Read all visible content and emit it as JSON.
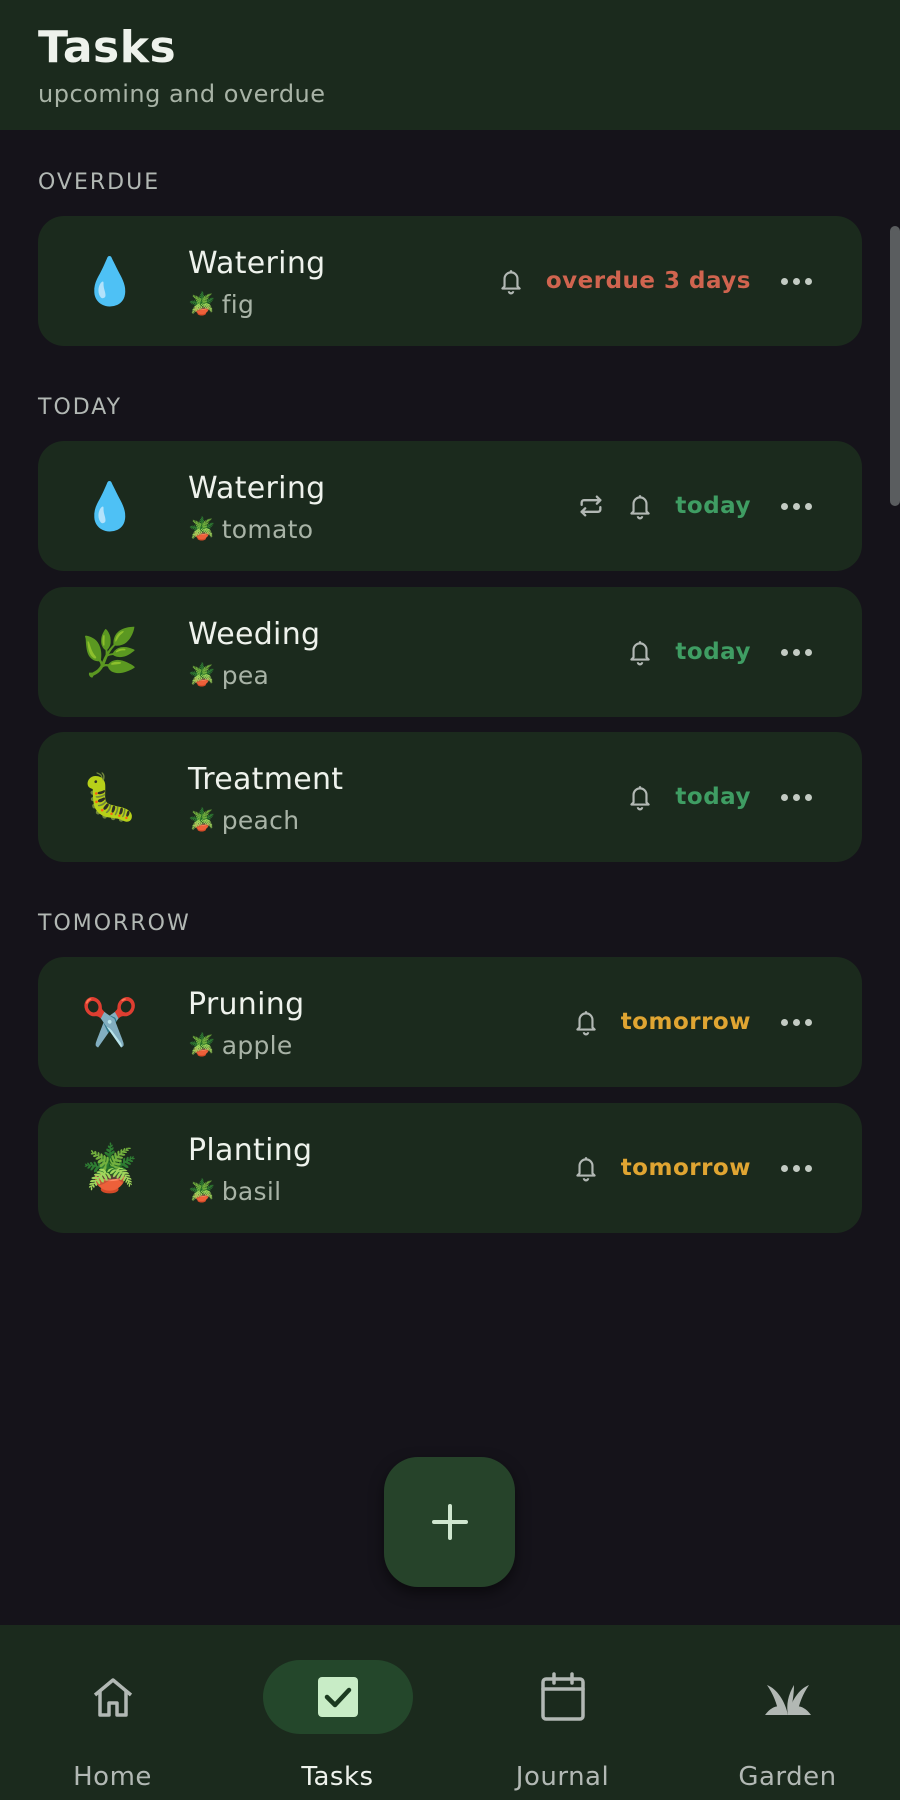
{
  "header": {
    "title": "Tasks",
    "subtitle": "upcoming and overdue"
  },
  "sections": {
    "overdue": "OVERDUE",
    "today": "TODAY",
    "tomorrow": "TOMORROW"
  },
  "tasks": [
    {
      "emoji": "💧",
      "name": "Watering",
      "plant_icon": "🪴",
      "plant": "fig",
      "due": "overdue 3 days",
      "status": "overdue",
      "repeat": false
    },
    {
      "emoji": "💧",
      "name": "Watering",
      "plant_icon": "🪴",
      "plant": "tomato",
      "due": "today",
      "status": "today",
      "repeat": true
    },
    {
      "emoji": "🌿",
      "name": "Weeding",
      "plant_icon": "🪴",
      "plant": "pea",
      "due": "today",
      "status": "today",
      "repeat": false
    },
    {
      "emoji": "🐛",
      "name": "Treatment",
      "plant_icon": "🪴",
      "plant": "peach",
      "due": "today",
      "status": "today",
      "repeat": false
    },
    {
      "emoji": "✂️",
      "name": "Pruning",
      "plant_icon": "🪴",
      "plant": "apple",
      "due": "tomorrow",
      "status": "tomorrow",
      "repeat": false
    },
    {
      "emoji": "🪴",
      "name": "Planting",
      "plant_icon": "🪴",
      "plant": "basil",
      "due": "tomorrow",
      "status": "tomorrow",
      "repeat": false
    }
  ],
  "nav": {
    "items": [
      {
        "label": "Home",
        "icon": "home-icon",
        "active": false
      },
      {
        "label": "Tasks",
        "icon": "checkbox-icon",
        "active": true
      },
      {
        "label": "Journal",
        "icon": "calendar-icon",
        "active": false
      },
      {
        "label": "Garden",
        "icon": "sprout-icon",
        "active": false
      }
    ]
  },
  "fab": {
    "icon": "plus-icon"
  },
  "colors": {
    "background": "#15131a",
    "surface": "#1b2a1d",
    "overdue": "#d0644f",
    "today": "#3f9d63",
    "tomorrow": "#e0a532",
    "fab": "#26432a",
    "active_pill": "#24472b"
  }
}
